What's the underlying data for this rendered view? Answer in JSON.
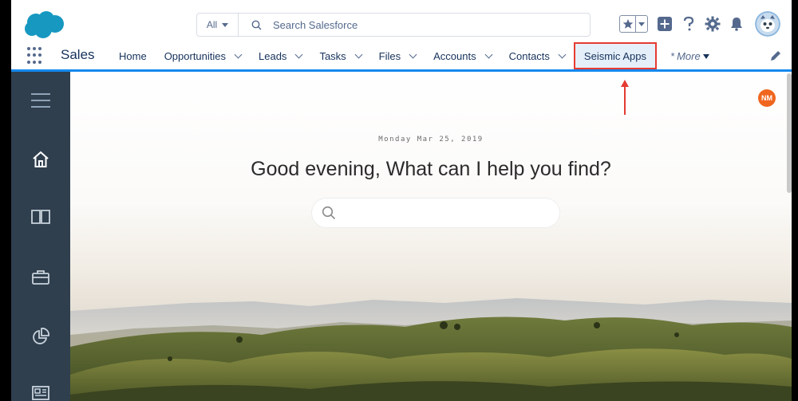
{
  "colors": {
    "brand_blue": "#1589ee",
    "sidebar_bg": "#2f3f4e",
    "highlight_red": "#e53b31",
    "active_tab_bg": "#e5eff9",
    "avatar_orange": "#f0661f"
  },
  "header": {
    "logo_icon": "salesforce-cloud-icon",
    "search_scope": "All",
    "search_placeholder": "Search Salesforce",
    "icons": [
      "favorites-star-icon",
      "favorites-dropdown-icon",
      "add-plus-icon",
      "help-icon",
      "setup-gear-icon",
      "notifications-bell-icon",
      "user-avatar"
    ]
  },
  "nav": {
    "app_name": "Sales",
    "tabs": [
      {
        "label": "Home",
        "has_menu": false
      },
      {
        "label": "Opportunities",
        "has_menu": true
      },
      {
        "label": "Leads",
        "has_menu": true
      },
      {
        "label": "Tasks",
        "has_menu": true
      },
      {
        "label": "Files",
        "has_menu": true
      },
      {
        "label": "Accounts",
        "has_menu": true
      },
      {
        "label": "Contacts",
        "has_menu": true
      },
      {
        "label": "Seismic Apps",
        "has_menu": false,
        "active": true
      }
    ],
    "more_prefix": "*",
    "more_label": "More"
  },
  "sidebar": {
    "items": [
      "menu-icon",
      "home-icon",
      "book-icon",
      "briefcase-icon",
      "pie-chart-icon",
      "news-icon"
    ]
  },
  "main": {
    "date": "Monday Mar 25, 2019",
    "greeting": "Good evening, What can I help you find?",
    "search_placeholder": "",
    "user_initials": "NM"
  }
}
